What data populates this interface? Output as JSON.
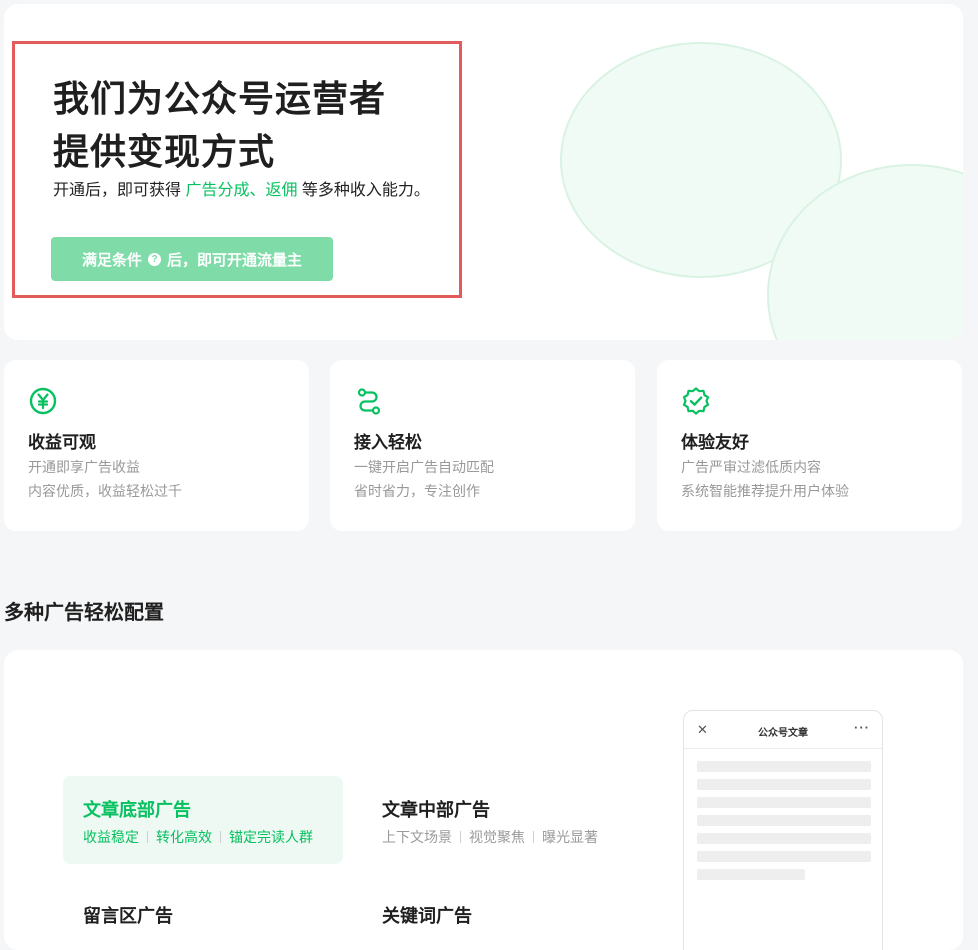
{
  "hero": {
    "title_line1": "我们为公众号运营者",
    "title_line2": "提供变现方式",
    "desc_prefix": "开通后，即可获得 ",
    "desc_highlight": "广告分成、返佣",
    "desc_suffix": " 等多种收入能力。",
    "button_prefix": "满足条件",
    "button_help_icon": "question-circle-icon",
    "button_suffix": "后，即可开通流量主",
    "accent_color": "#07c160",
    "button_color": "#7fdca9",
    "highlight_border_color": "#e25a5a"
  },
  "features": [
    {
      "icon": "yuan-circle-icon",
      "title": "收益可观",
      "line1": "开通即享广告收益",
      "line2": "内容优质，收益轻松过千"
    },
    {
      "icon": "route-connect-icon",
      "title": "接入轻松",
      "line1": "一键开启广告自动匹配",
      "line2": "省时省力，专注创作"
    },
    {
      "icon": "badge-check-icon",
      "title": "体验友好",
      "line1": "广告严审过滤低质内容",
      "line2": "系统智能推荐提升用户体验"
    }
  ],
  "ads_section": {
    "title": "多种广告轻松配置",
    "items": [
      {
        "title": "文章底部广告",
        "tags": [
          "收益稳定",
          "转化高效",
          "锚定完读人群"
        ],
        "active": true
      },
      {
        "title": "文章中部广告",
        "tags": [
          "上下文场景",
          "视觉聚焦",
          "曝光显著"
        ],
        "active": false
      },
      {
        "title": "留言区广告",
        "tags": [],
        "active": false
      },
      {
        "title": "关键词广告",
        "tags": [],
        "active": false
      }
    ],
    "preview": {
      "title": "公众号文章",
      "close_icon": "close-icon",
      "more_icon": "more-dots-icon"
    }
  }
}
